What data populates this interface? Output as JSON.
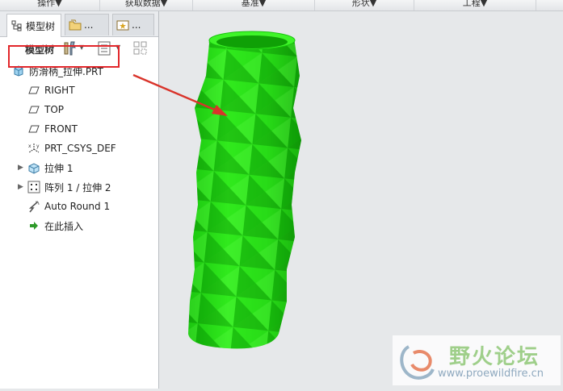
{
  "ribbon": {
    "groups": [
      {
        "label": "操作▼"
      },
      {
        "label": "获取数据▼"
      },
      {
        "label": "基准▼"
      },
      {
        "label": "形状▼"
      },
      {
        "label": "工程▼"
      }
    ]
  },
  "tabs": [
    {
      "label": "模型树"
    },
    {
      "label": "..."
    },
    {
      "label": "..."
    }
  ],
  "toolbar": {
    "label": "模型树"
  },
  "tree": {
    "root": "防滑柄_拉伸.PRT",
    "items": [
      {
        "label": "RIGHT",
        "icon": "datum-plane-icon"
      },
      {
        "label": "TOP",
        "icon": "datum-plane-icon"
      },
      {
        "label": "FRONT",
        "icon": "datum-plane-icon"
      },
      {
        "label": "PRT_CSYS_DEF",
        "icon": "csys-icon"
      },
      {
        "label": "拉伸 1",
        "icon": "extrude-icon",
        "expandable": true
      },
      {
        "label": "阵列 1 / 拉伸 2",
        "icon": "pattern-icon",
        "expandable": true
      },
      {
        "label": "Auto Round 1",
        "icon": "round-icon"
      },
      {
        "label": "在此插入",
        "icon": "insert-here-icon"
      }
    ]
  },
  "colors": {
    "model_green": "#22e014",
    "highlight_red": "#e2262a",
    "arrow_red": "#d9342b"
  },
  "watermark": {
    "title": "野火论坛",
    "url": "www.proewildfire.cn"
  }
}
